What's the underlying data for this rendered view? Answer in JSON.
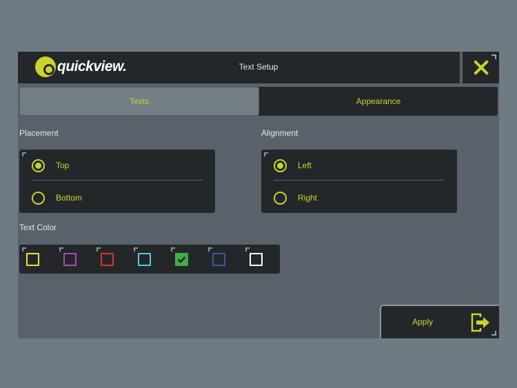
{
  "header": {
    "logo_text": "quickview.",
    "title": "Text Setup",
    "close_icon": "close-x-icon"
  },
  "tabs": [
    {
      "label": "Texts",
      "active": true
    },
    {
      "label": "Appearance",
      "active": false
    }
  ],
  "placement": {
    "label": "Placement",
    "options": [
      {
        "label": "Top",
        "checked": true
      },
      {
        "label": "Bottom",
        "checked": false
      }
    ]
  },
  "alignment": {
    "label": "Alignment",
    "options": [
      {
        "label": "Left",
        "checked": true
      },
      {
        "label": "Right",
        "checked": false
      }
    ]
  },
  "text_color": {
    "label": "Text Color",
    "swatches": [
      {
        "color": "#e8e22e",
        "selected": false
      },
      {
        "color": "#a64db8",
        "selected": false
      },
      {
        "color": "#e0302b",
        "selected": false
      },
      {
        "color": "#5fc4e6",
        "selected": false
      },
      {
        "color": "#3fae49",
        "selected": true
      },
      {
        "color": "#3a55b4",
        "selected": false
      },
      {
        "color": "#ffffff",
        "selected": false
      }
    ]
  },
  "apply": {
    "label": "Apply",
    "icon": "exit-arrow-icon"
  },
  "colors": {
    "accent": "#c9d52a",
    "panel": "#23272a",
    "background": "#59626a"
  }
}
